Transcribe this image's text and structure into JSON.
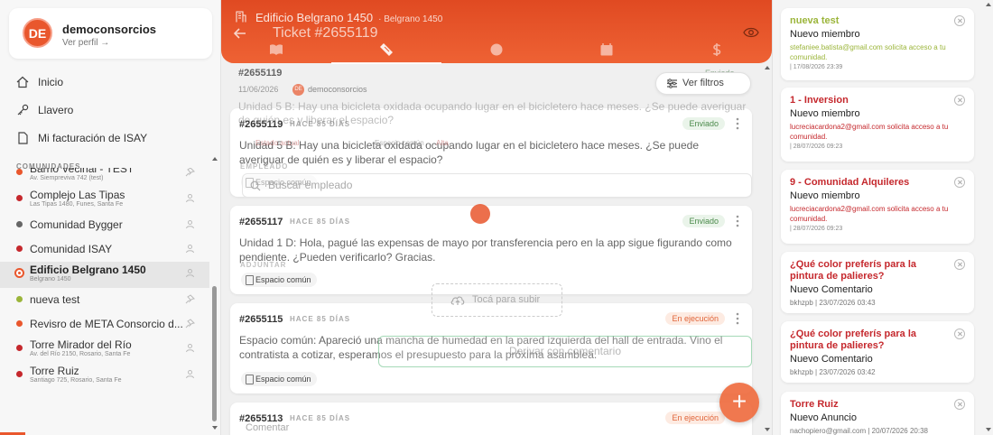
{
  "profile": {
    "avatar_initials": "DE",
    "name": "democonsorcios",
    "link": "Ver perfil →"
  },
  "nav": [
    {
      "label": "Inicio",
      "icon": "home-icon"
    },
    {
      "label": "Llavero",
      "icon": "key-icon"
    },
    {
      "label": "Mi facturación de ISAY",
      "icon": "document-icon"
    }
  ],
  "communities_label": "COMUNIDADES",
  "communities": [
    {
      "name": "Barrio Vecinal - TEST",
      "address": "Av. Siempreviva 742 (test)",
      "color": "#e9572d",
      "icon": "pin-icon"
    },
    {
      "name": "Complejo Las Tipas",
      "address": "Las Tipas 1480, Funes, Santa Fe",
      "color": "#c5282d",
      "icon": "person-icon"
    },
    {
      "name": "Comunidad Bygger",
      "address": "",
      "color": "#666666",
      "icon": "person-icon"
    },
    {
      "name": "Comunidad ISAY",
      "address": "",
      "color": "#c5282d",
      "icon": "person-icon"
    },
    {
      "name": "Edificio Belgrano 1450",
      "address": "Belgrano 1450",
      "color": "#e9572d",
      "icon": "person-icon",
      "selected": true
    },
    {
      "name": "nueva test",
      "address": "",
      "color": "#9bb53a",
      "icon": "pin-icon"
    },
    {
      "name": "Revisro de META Consorcio d...",
      "address": "",
      "color": "#e9572d",
      "icon": "pin-icon"
    },
    {
      "name": "Torre Mirador del Río",
      "address": "Av. del Río 2150, Rosario, Santa Fe",
      "color": "#c5282d",
      "icon": "person-icon"
    },
    {
      "name": "Torre Ruiz",
      "address": "Santiago 725, Rosario, Santa Fe",
      "color": "#c5282d",
      "icon": "person-icon"
    }
  ],
  "header": {
    "building": "Edificio Belgrano 1450",
    "building_sub": "· Belgrano 1450",
    "ticket": "Ticket #2655119"
  },
  "overlay": {
    "ticket_num": "#2655119",
    "date": "11/06/2026",
    "user_initials": "DE",
    "user": "democonsorcios",
    "status": "Enviado ⌄",
    "filter_label": "Ver filtros",
    "description": "Unidad 5 B: Hay una bicicleta oxidada ocupando lugar en el bicicletero hace meses. ¿Se puede averiguar de quién es y liberar el espacio?",
    "employee_label": "EMPLEADO",
    "search_placeholder": "Buscar empleado",
    "attach_label": "ADJUNTAR",
    "upload_label": "Tocá para subir",
    "submit_label": "Derivar con comentario",
    "comment_placeholder": "Comentar",
    "tiny_a": "Estado actual",
    "tiny_b": "Espacio común",
    "tiny_c": "Alta"
  },
  "tickets": [
    {
      "num": "#2655119",
      "ago": "HACE 85 DÍAS",
      "status": "Enviado",
      "status_type": "enviado",
      "body": "Unidad 5 B: Hay una bicicleta oxidada ocupando lugar en el bicicletero hace meses. ¿Se puede averiguar de quién es y liberar el espacio?",
      "chip": "Espacio común"
    },
    {
      "num": "#2655117",
      "ago": "HACE 85 DÍAS",
      "status": "Enviado",
      "status_type": "enviado",
      "body": "Unidad 1 D: Hola, pagué las expensas de mayo por transferencia pero en la app sigue figurando como pendiente. ¿Pueden verificarlo? Gracias.",
      "chip": "Espacio común"
    },
    {
      "num": "#2655115",
      "ago": "HACE 85 DÍAS",
      "status": "En ejecución",
      "status_type": "ejec",
      "body": "Espacio común: Apareció una mancha de humedad en la pared izquierda del hall de entrada. Vino el contratista a cotizar, esperamos el presupuesto para la próxima asamblea.",
      "chip": "Espacio común"
    },
    {
      "num": "#2655113",
      "ago": "HACE 85 DÍAS",
      "status": "En ejecución",
      "status_type": "ejec",
      "body": "",
      "chip": ""
    }
  ],
  "fab_label": "+",
  "notifications": [
    {
      "title": "nueva test",
      "title_color": "green",
      "type": "Nuevo miembro",
      "detail": "stefaniee.batista@gmail.com solicita acceso a tu comunidad.",
      "detail_color": "green",
      "time": "| 17/08/2026 23:39"
    },
    {
      "title": "1 - Inversion",
      "title_color": "red",
      "type": "Nuevo miembro",
      "detail": "lucreciacardona2@gmail.com solicita acceso a tu comunidad.",
      "detail_color": "red",
      "time": "| 28/07/2026 09:23"
    },
    {
      "title": "9 - Comunidad Alquileres",
      "title_color": "red",
      "type": "Nuevo miembro",
      "detail": "lucreciacardona2@gmail.com solicita acceso a tu comunidad.",
      "detail_color": "red",
      "time": "| 28/07/2026 09:23"
    },
    {
      "title": "¿Qué color preferís para la pintura de palieres?",
      "title_color": "red",
      "type": "Nuevo Comentario",
      "detail": "bkhzpb | 23/07/2026 03:43",
      "detail_color": "gray",
      "time": ""
    },
    {
      "title": "¿Qué color preferís para la pintura de palieres?",
      "title_color": "red",
      "type": "Nuevo Comentario",
      "detail": "bkhzpb | 23/07/2026 03:42",
      "detail_color": "gray",
      "time": ""
    },
    {
      "title": "Torre Ruiz",
      "title_color": "red",
      "type": "Nuevo Anuncio",
      "detail": "nachopiero@gmail.com | 20/07/2026 20:38",
      "detail_color": "gray",
      "time": ""
    }
  ],
  "colors": {
    "brand": "#e9572d",
    "accent_red": "#c5282d",
    "accent_green": "#9bb53a"
  }
}
